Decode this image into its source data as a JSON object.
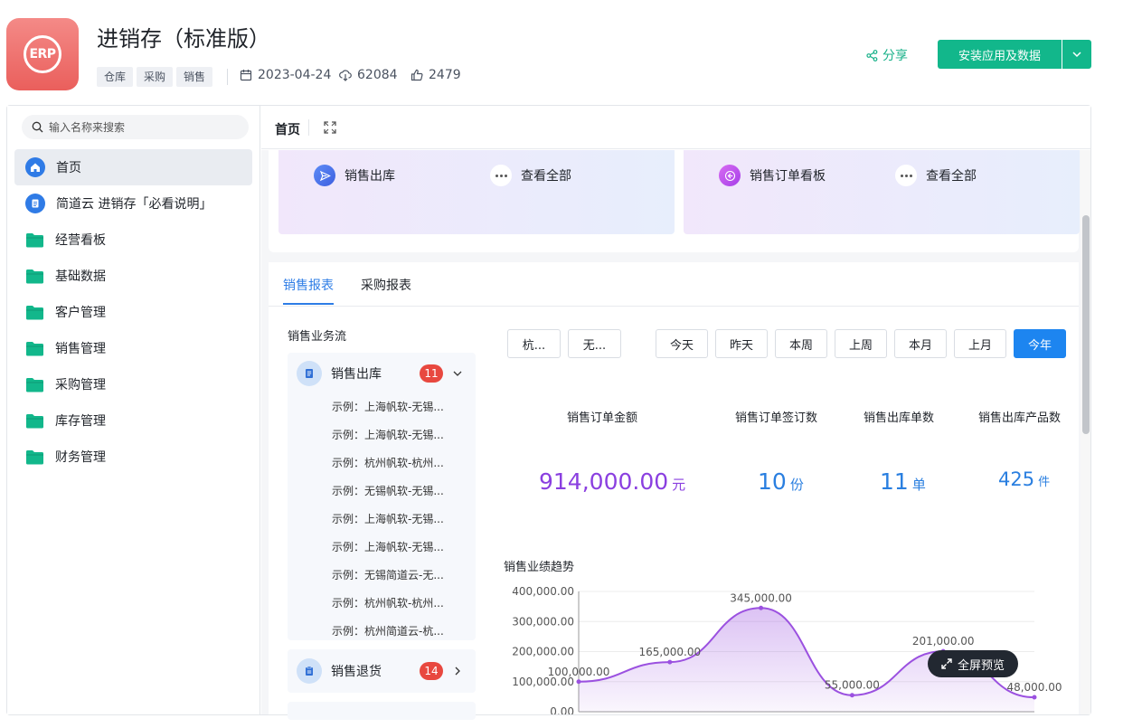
{
  "app": {
    "logo_text": "ERP",
    "title": "进销存（标准版）",
    "tags": [
      "仓库",
      "采购",
      "销售"
    ],
    "date": "2023-04-24",
    "downloads": "62084",
    "likes": "2479",
    "share_label": "分享",
    "install_label": "安装应用及数据"
  },
  "sidebar": {
    "search_placeholder": "输入名称来搜索",
    "items": [
      {
        "label": "首页",
        "icon": "home-icon",
        "active": true
      },
      {
        "label": "简道云 进销存「必看说明」",
        "icon": "document-icon"
      },
      {
        "label": "经营看板",
        "icon": "folder-icon"
      },
      {
        "label": "基础数据",
        "icon": "folder-icon"
      },
      {
        "label": "客户管理",
        "icon": "folder-icon"
      },
      {
        "label": "销售管理",
        "icon": "folder-icon"
      },
      {
        "label": "采购管理",
        "icon": "folder-icon"
      },
      {
        "label": "库存管理",
        "icon": "folder-icon"
      },
      {
        "label": "财务管理",
        "icon": "folder-icon"
      }
    ]
  },
  "page": {
    "title": "首页"
  },
  "quick": {
    "panel1": {
      "item": "销售出库",
      "view_all": "查看全部"
    },
    "panel2": {
      "item": "销售订单看板",
      "view_all": "查看全部"
    }
  },
  "tabs": [
    {
      "label": "销售报表",
      "active": true
    },
    {
      "label": "采购报表",
      "active": false
    }
  ],
  "flow": {
    "title": "销售业务流",
    "group1": {
      "label": "销售出库",
      "count": "11",
      "entries": [
        "示例：上海帆软-无锡...",
        "示例：上海帆软-无锡...",
        "示例：杭州帆软-杭州...",
        "示例：无锡帆软-无锡...",
        "示例：上海帆软-无锡...",
        "示例：上海帆软-无锡...",
        "示例：无锡简道云-无...",
        "示例：杭州帆软-杭州...",
        "示例：杭州简道云-杭..."
      ]
    },
    "group2": {
      "label": "销售退货",
      "count": "14"
    }
  },
  "filters": {
    "selects": [
      "杭...",
      "无..."
    ],
    "periods": [
      "今天",
      "昨天",
      "本周",
      "上周",
      "本月",
      "上月",
      "今年"
    ],
    "active_period": "今年"
  },
  "kpis": [
    {
      "label": "销售订单金额",
      "value": "914,000.00",
      "unit": "元",
      "color": "#8a3fe0"
    },
    {
      "label": "销售订单签订数",
      "value": "10",
      "unit": "份",
      "color": "#2a7fe0"
    },
    {
      "label": "销售出库单数",
      "value": "11",
      "unit": "单",
      "color": "#2a7fe0"
    },
    {
      "label": "销售出库产品数",
      "value": "425",
      "unit": "件",
      "color": "#2a7fe0"
    }
  ],
  "trend": {
    "title": "销售业绩趋势"
  },
  "chart_data": {
    "type": "area",
    "title": "销售业绩趋势",
    "xlabel": "",
    "ylabel": "",
    "ylim": [
      0,
      400000
    ],
    "y_ticks": [
      "400,000.00",
      "300,000.00",
      "200,000.00",
      "100,000.00",
      "0.00"
    ],
    "series": [
      {
        "values": [
          100000,
          165000,
          345000,
          55000,
          201000,
          48000
        ],
        "labels": [
          "100,000.00",
          "165,000.00",
          "345,000.00",
          "55,000.00",
          "201,000.00",
          "48,000.00"
        ],
        "color": "#9b51e0"
      }
    ],
    "grid": true
  },
  "fullscreen_label": "全屏预览"
}
